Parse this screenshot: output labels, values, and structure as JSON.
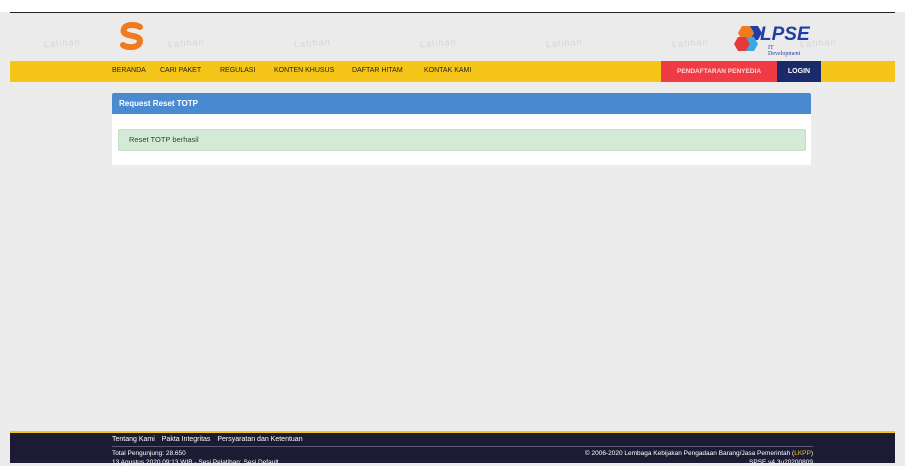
{
  "watermark_text": "Latihan",
  "header": {
    "lpse_logo_text": "LPSE",
    "lpse_logo_sub": "IT Development"
  },
  "nav": {
    "items": [
      "BERANDA",
      "CARI PAKET",
      "REGULASI",
      "KONTEN KHUSUS",
      "DAFTAR HITAM",
      "KONTAK KAMI"
    ],
    "register": "PENDAFTARAN PENYEDIA",
    "login": "LOGIN"
  },
  "panel": {
    "title": "Request Reset TOTP",
    "alert": "Reset TOTP berhasil"
  },
  "footer": {
    "links": [
      "Tentang Kami",
      "Pakta Integritas",
      "Persyaratan dan Ketentuan"
    ],
    "visitors": "Total Pengunjung: 28.650",
    "date": "13 Agustus 2020 09:13 WIB - Sesi Pelatihan: Sesi Default",
    "copyright_prefix": "© 2006-2020 Lembaga Kebijakan Pengadaan Barang/Jasa Pemerintah (",
    "copyright_lkpp": "LKPP",
    "copyright_suffix": ")",
    "version": "SPSE v4.3u20200809"
  },
  "colors": {
    "nav_bg": "#f5c518",
    "panel_head": "#4a8ad1",
    "register_bg": "#f03b45",
    "login_bg": "#1b2a6b",
    "footer_bg": "#1b1c33"
  }
}
